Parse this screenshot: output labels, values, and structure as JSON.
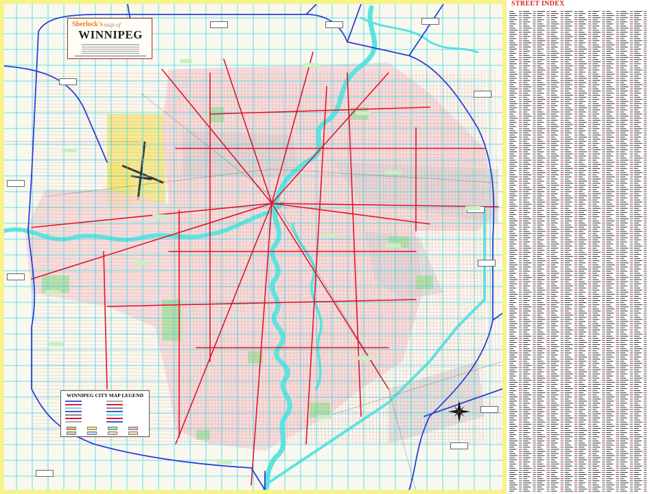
{
  "map": {
    "title_publisher": "Sherlock's",
    "title_tag": "map of",
    "title_city": "WINNIPEG",
    "legend_title": "WINNIPEG CITY MAP LEGEND",
    "colors": {
      "border": "#f6f38a",
      "water": "#6ee6e0",
      "grid": "#3fd3e6",
      "major_road": "#e3122a",
      "highway": "#2a3fd6",
      "park": "#a8e6a0",
      "industrial": "#c9c9c9",
      "airport": "#f3e36a",
      "residential": "#f2c7c7"
    },
    "icons": [
      "compass-rose-icon"
    ]
  },
  "index": {
    "title": "STREET INDEX"
  }
}
